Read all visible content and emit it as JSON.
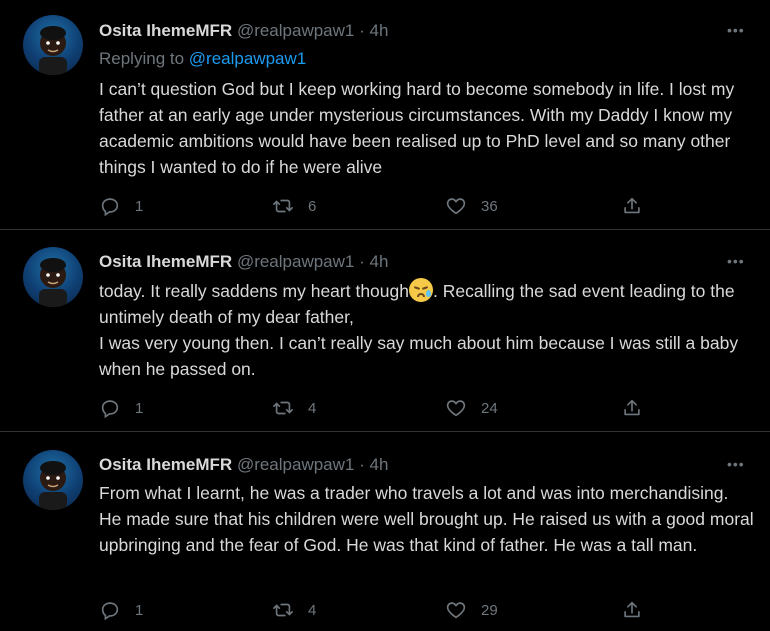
{
  "tweets": [
    {
      "name": "Osita IhemeMFR",
      "handle": "@realpawpaw1",
      "time": "4h",
      "replying_prefix": "Replying to ",
      "replying_to": "@realpawpaw1",
      "text": "I can’t question God but I keep working hard to become somebody in life. I lost my father at an early age under mysterious circumstances. With my Daddy I know my academic ambitions would have been realised up to PhD level and so many other things I wanted to do if he were alive",
      "replies": "1",
      "retweets": "6",
      "likes": "36"
    },
    {
      "name": "Osita IhemeMFR",
      "handle": "@realpawpaw1",
      "time": "4h",
      "text_part1": "today. It really saddens my heart though",
      "text_part2": ". Recalling the sad event leading to the untimely death of my dear father,\nI was very young then. I can’t really say much about him because I was still a baby when he passed on.",
      "replies": "1",
      "retweets": "4",
      "likes": "24"
    },
    {
      "name": "Osita IhemeMFR",
      "handle": "@realpawpaw1",
      "time": "4h",
      "text": "From what I learnt, he was a trader who travels a lot and was into merchandising. He made sure that his children were well brought up. He raised us with a good moral upbringing and the fear of God. He was that kind of father. He was a tall man.",
      "replies": "1",
      "retweets": "4",
      "likes": "29"
    }
  ],
  "icons": {
    "reply": "reply-icon",
    "retweet": "retweet-icon",
    "like": "heart-icon",
    "share": "share-icon",
    "more": "more-dots-icon",
    "emoji": "disappointed-face-emoji"
  },
  "colors": {
    "background": "#000000",
    "text": "#d9d9d9",
    "muted": "#6e767d",
    "link": "#1d9bf0"
  },
  "separator": " · ",
  "more_glyph": "•••"
}
